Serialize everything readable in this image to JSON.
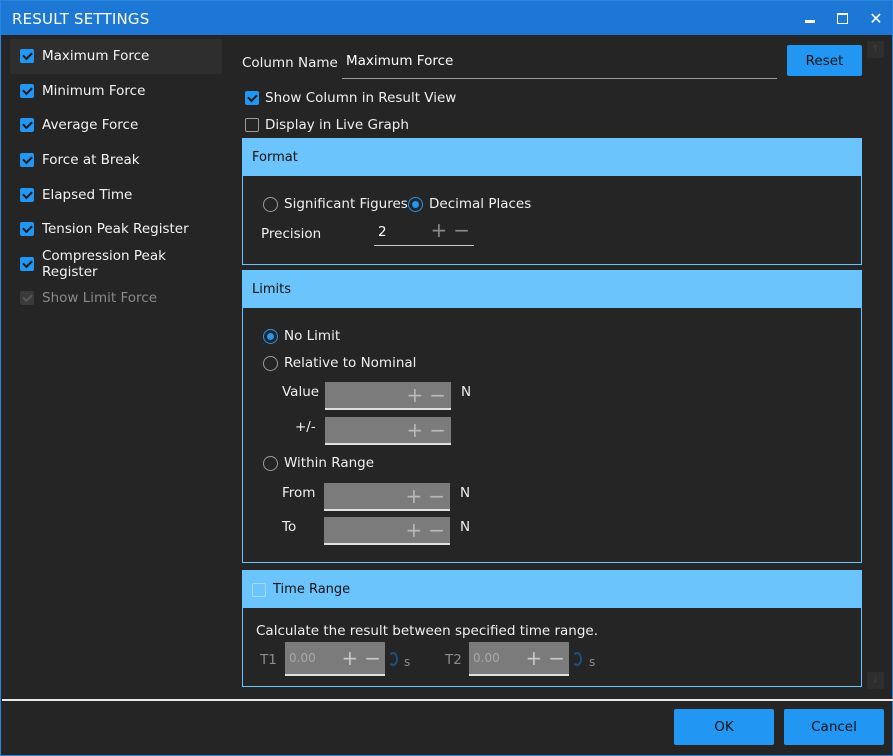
{
  "window": {
    "title": "RESULT SETTINGS",
    "minimize_icon": "minimize-icon",
    "maximize_icon": "maximize-icon",
    "close_icon": "close-icon",
    "close_glyph": "✕"
  },
  "sidebar": {
    "items": [
      {
        "label": "Maximum Force",
        "checked": true,
        "selected": true,
        "enabled": true
      },
      {
        "label": "Minimum Force",
        "checked": true,
        "selected": false,
        "enabled": true
      },
      {
        "label": "Average Force",
        "checked": true,
        "selected": false,
        "enabled": true
      },
      {
        "label": "Force at Break",
        "checked": true,
        "selected": false,
        "enabled": true
      },
      {
        "label": "Elapsed Time",
        "checked": true,
        "selected": false,
        "enabled": true
      },
      {
        "label": "Tension Peak Register",
        "checked": true,
        "selected": false,
        "enabled": true
      },
      {
        "label": "Compression Peak Register",
        "checked": true,
        "selected": false,
        "enabled": true
      },
      {
        "label": "Show Limit Force",
        "checked": true,
        "selected": false,
        "enabled": false
      }
    ]
  },
  "main": {
    "column_name_label": "Column Name",
    "column_name_value": "Maximum Force",
    "reset_label": "Reset",
    "show_column_label": "Show Column in Result View",
    "show_column_checked": true,
    "display_live_graph_label": "Display in Live Graph",
    "display_live_graph_checked": false,
    "format": {
      "header": "Format",
      "significant_figures_label": "Significant Figures",
      "decimal_places_label": "Decimal Places",
      "selected": "Decimal Places",
      "precision_label": "Precision",
      "precision_value": "2",
      "plus": "+",
      "minus": "−"
    },
    "limits": {
      "header": "Limits",
      "no_limit_label": "No Limit",
      "relative_label": "Relative to Nominal",
      "within_range_label": "Within Range",
      "selected": "No Limit",
      "value_label": "Value",
      "plusminus_label": "+/-",
      "from_label": "From",
      "to_label": "To",
      "unit": "N",
      "plus": "+",
      "minus": "−"
    },
    "time_range": {
      "header": "Time Range",
      "checked": false,
      "description": "Calculate the result between specified time range.",
      "t1_label": "T1",
      "t1_value": "0.00",
      "t2_label": "T2",
      "t2_value": "0.00",
      "unit": "s",
      "plus": "+",
      "minus": "−"
    }
  },
  "scroll": {
    "up_glyph": "↑",
    "down_glyph": "↓"
  },
  "footer": {
    "ok_label": "OK",
    "cancel_label": "Cancel"
  },
  "colors": {
    "titlebar": "#1c78d4",
    "accent": "#2196f3",
    "panel_header": "#6cc4fc",
    "background": "#252525"
  }
}
